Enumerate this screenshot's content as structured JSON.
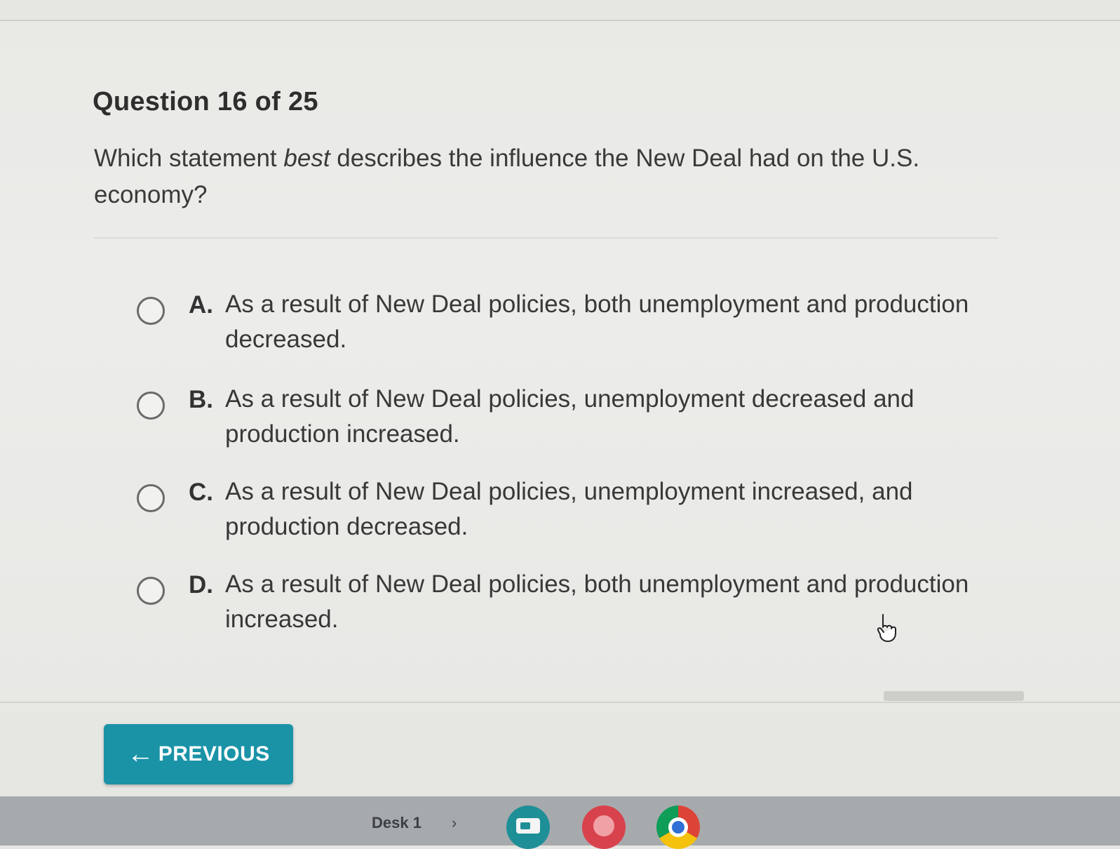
{
  "question": {
    "number_label": "Question 16 of 25",
    "prompt_before": "Which statement ",
    "prompt_emphasis": "best",
    "prompt_after": " describes the influence the New Deal had on the U.S. economy?"
  },
  "choices": [
    {
      "letter": "A.",
      "text": "As a result of New Deal policies, both unemployment and production decreased."
    },
    {
      "letter": "B.",
      "text": "As a result of New Deal policies, unemployment decreased and production increased."
    },
    {
      "letter": "C.",
      "text": "As a result of New Deal policies, unemployment increased, and production decreased."
    },
    {
      "letter": "D.",
      "text": "As a result of New Deal policies, both unemployment and production increased."
    }
  ],
  "nav": {
    "previous_label": "PREVIOUS",
    "previous_arrow": "←"
  },
  "shelf": {
    "desk_label": "Desk 1",
    "chevron": "›",
    "apps": [
      "classroom-app-icon",
      "paint-app-icon",
      "chrome-icon"
    ]
  },
  "colors": {
    "accent": "#1a93a7"
  }
}
